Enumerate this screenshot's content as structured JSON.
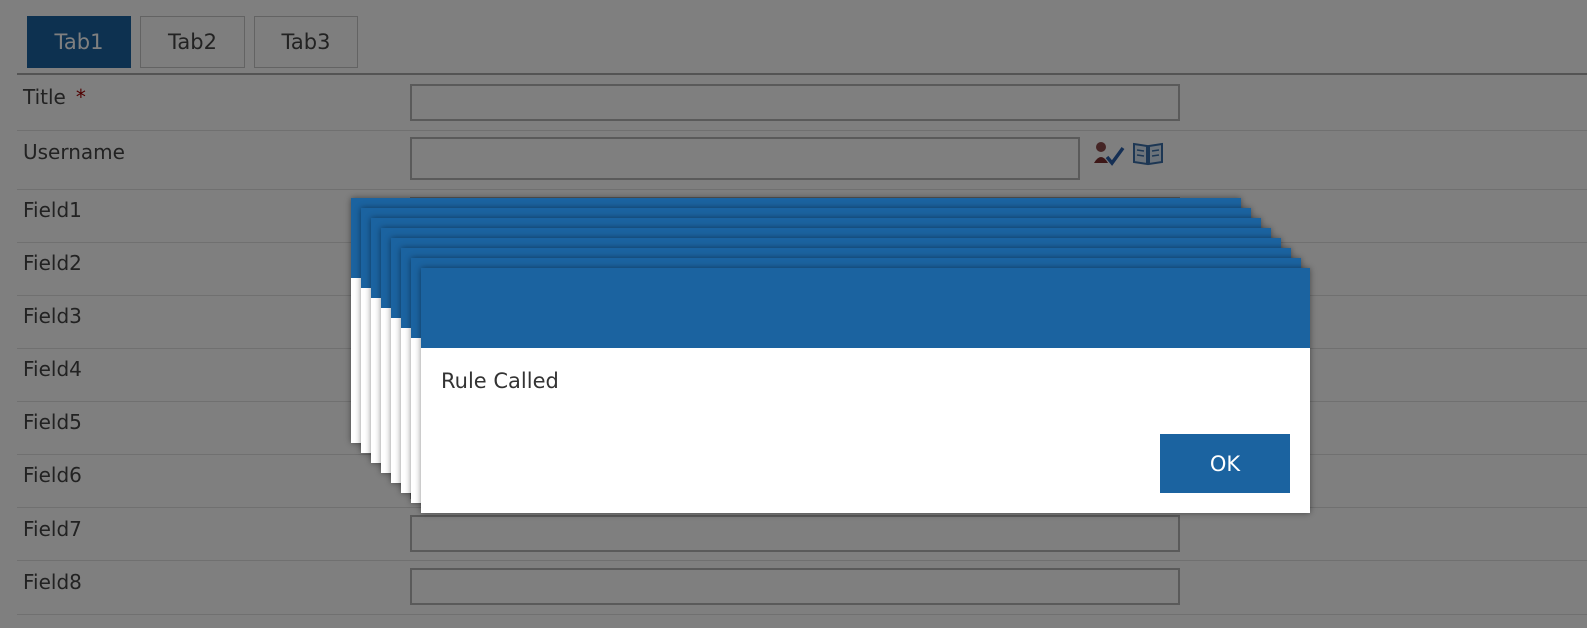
{
  "tabs": [
    {
      "label": "Tab1",
      "active": true
    },
    {
      "label": "Tab2",
      "active": false
    },
    {
      "label": "Tab3",
      "active": false
    }
  ],
  "form": {
    "required_marker": "*",
    "fields": [
      {
        "label": "Title",
        "value": "",
        "required": true
      },
      {
        "label": "Username",
        "value": "",
        "people_picker": true
      },
      {
        "label": "Field1",
        "value": ""
      },
      {
        "label": "Field2",
        "value": ""
      },
      {
        "label": "Field3",
        "value": ""
      },
      {
        "label": "Field4",
        "value": ""
      },
      {
        "label": "Field5",
        "value": ""
      },
      {
        "label": "Field6",
        "value": ""
      },
      {
        "label": "Field7",
        "value": ""
      },
      {
        "label": "Field8",
        "value": ""
      }
    ],
    "people_picker_icons": [
      "check-names-icon",
      "address-book-icon"
    ]
  },
  "dialog": {
    "message": "Rule Called",
    "ok_label": "OK",
    "stacked_copies": 8
  },
  "colors": {
    "accent": "#1b63a0",
    "overlay": "rgba(0,0,0,0.5)",
    "required": "#a00000"
  }
}
